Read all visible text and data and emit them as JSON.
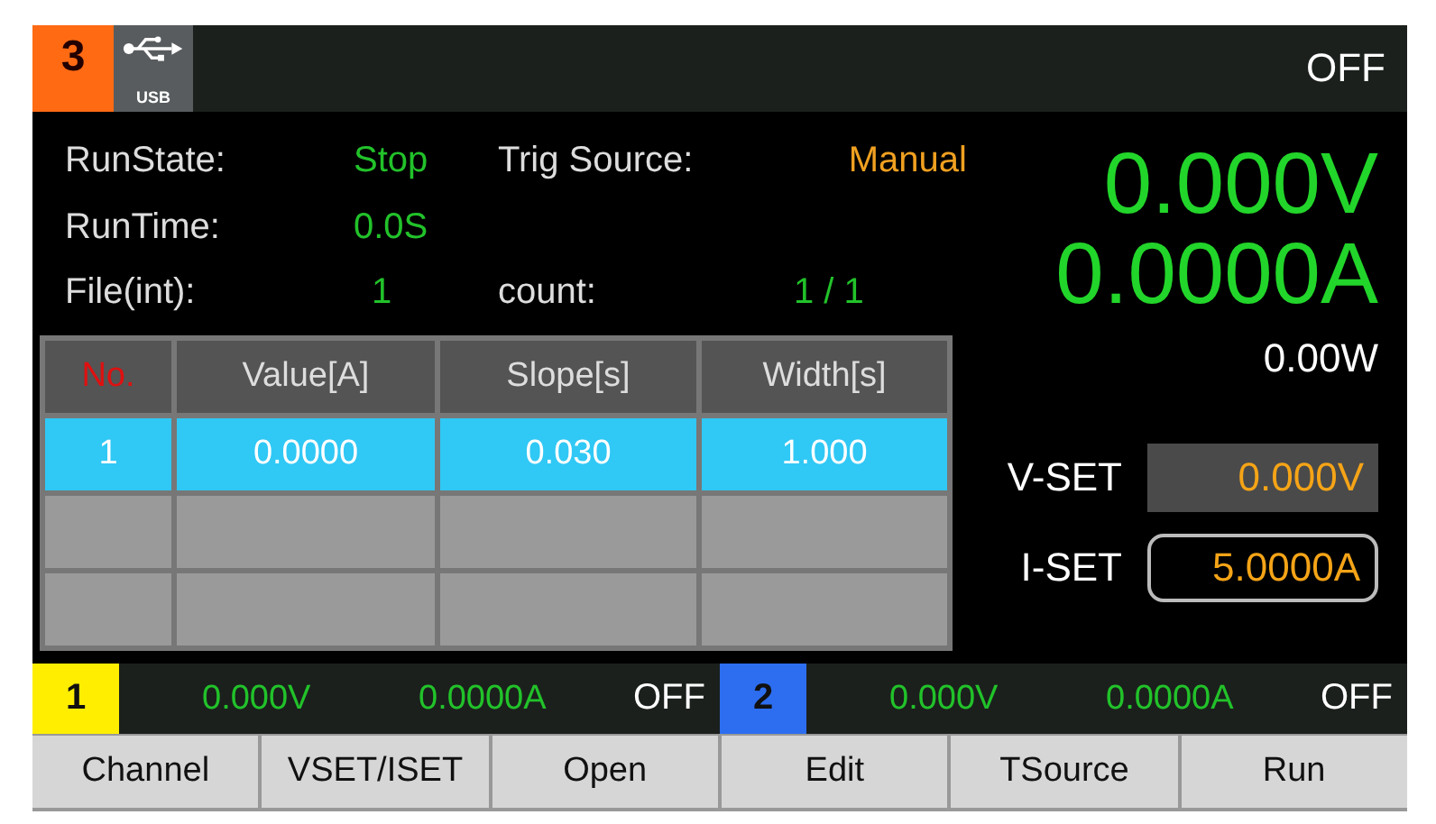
{
  "top_bar": {
    "channel": "3",
    "usb_label": "USB",
    "output": "OFF"
  },
  "params": [
    {
      "label": "RunState:",
      "value": "Stop",
      "color": "#22c22a"
    },
    {
      "label": "Trig Source:",
      "value": "Manual",
      "color": "#f0a020"
    },
    {
      "label": "RunTime:",
      "value": "0.0S",
      "color": "#22c22a"
    },
    {
      "label": "File(int):",
      "value": "1",
      "color": "#22c22a"
    },
    {
      "label": "count:",
      "value": "1 / 1",
      "color": "#22c22a"
    }
  ],
  "readings": {
    "voltage": "0.000V",
    "current": "0.0000A",
    "power": "0.00W"
  },
  "table": {
    "columns": [
      "No.",
      "Value[A]",
      "Slope[s]",
      "Width[s]"
    ],
    "rows": [
      {
        "cells": [
          "1",
          "0.0000",
          "0.030",
          "1.000"
        ],
        "selected": true
      }
    ]
  },
  "settings": [
    {
      "label": "V-SET",
      "value": "0.000V",
      "selected": false
    },
    {
      "label": "I-SET",
      "value": "5.0000A",
      "selected": true
    }
  ],
  "channels": [
    {
      "number": "1",
      "color": "#ffee00",
      "voltage": "0.000V",
      "current": "0.0000A",
      "output": "OFF"
    },
    {
      "number": "2",
      "color": "#2d6ef0",
      "voltage": "0.000V",
      "current": "0.0000A",
      "output": "OFF"
    }
  ],
  "softkeys": [
    "Channel",
    "VSET/ISET",
    "Open",
    "Edit",
    "TSource",
    "Run"
  ]
}
